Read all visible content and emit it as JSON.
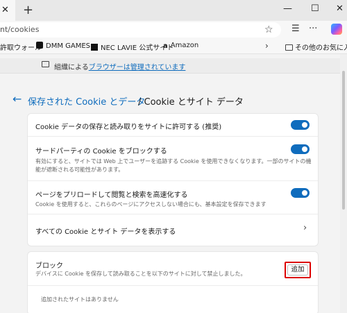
{
  "window": {
    "tab_close": "✕",
    "new_tab": "+",
    "min": "—",
    "max": "☐",
    "close": "✕"
  },
  "address_bar": {
    "url": "nt/cookies"
  },
  "favorites": {
    "items": [
      "許取ウォール",
      "DMM GAMES",
      "NEC LAVIE 公式サイト",
      "Amazon"
    ],
    "other_folder": "その他のお気に入り"
  },
  "managed_notice": {
    "prefix": "組織による",
    "link": "ブラウザーは管理されています"
  },
  "page": {
    "breadcrumb_parent": "保存された Cookie とデータ",
    "breadcrumb_current": "/ Cookie とサイト データ"
  },
  "settings": [
    {
      "title": "Cookie データの保存と読み取りをサイトに許可する (推奨)",
      "desc": "",
      "toggle": true
    },
    {
      "title": "サードパーティの Cookie をブロックする",
      "desc": "有効にすると、サイトでは Web 上でユーザーを追跡する Cookie を使用できなくなります。一部のサイトの機能が遮断される可能性があります。",
      "toggle": true
    },
    {
      "title": "ページをプリロードして閲覧と検索を高速化する",
      "desc": "Cookie を使用すると、これらのページにアクセスしない場合にも、基本設定を保存できます",
      "toggle": true
    },
    {
      "title": "すべての Cookie とサイト データを表示する",
      "desc": "",
      "chevron": "›"
    }
  ],
  "block": {
    "title": "ブロック",
    "desc": "デバイスに Cookie を保存して読み取ることを以下のサイトに対して禁止しました。",
    "add_label": "追加",
    "empty": "追加されたサイトはありません"
  }
}
